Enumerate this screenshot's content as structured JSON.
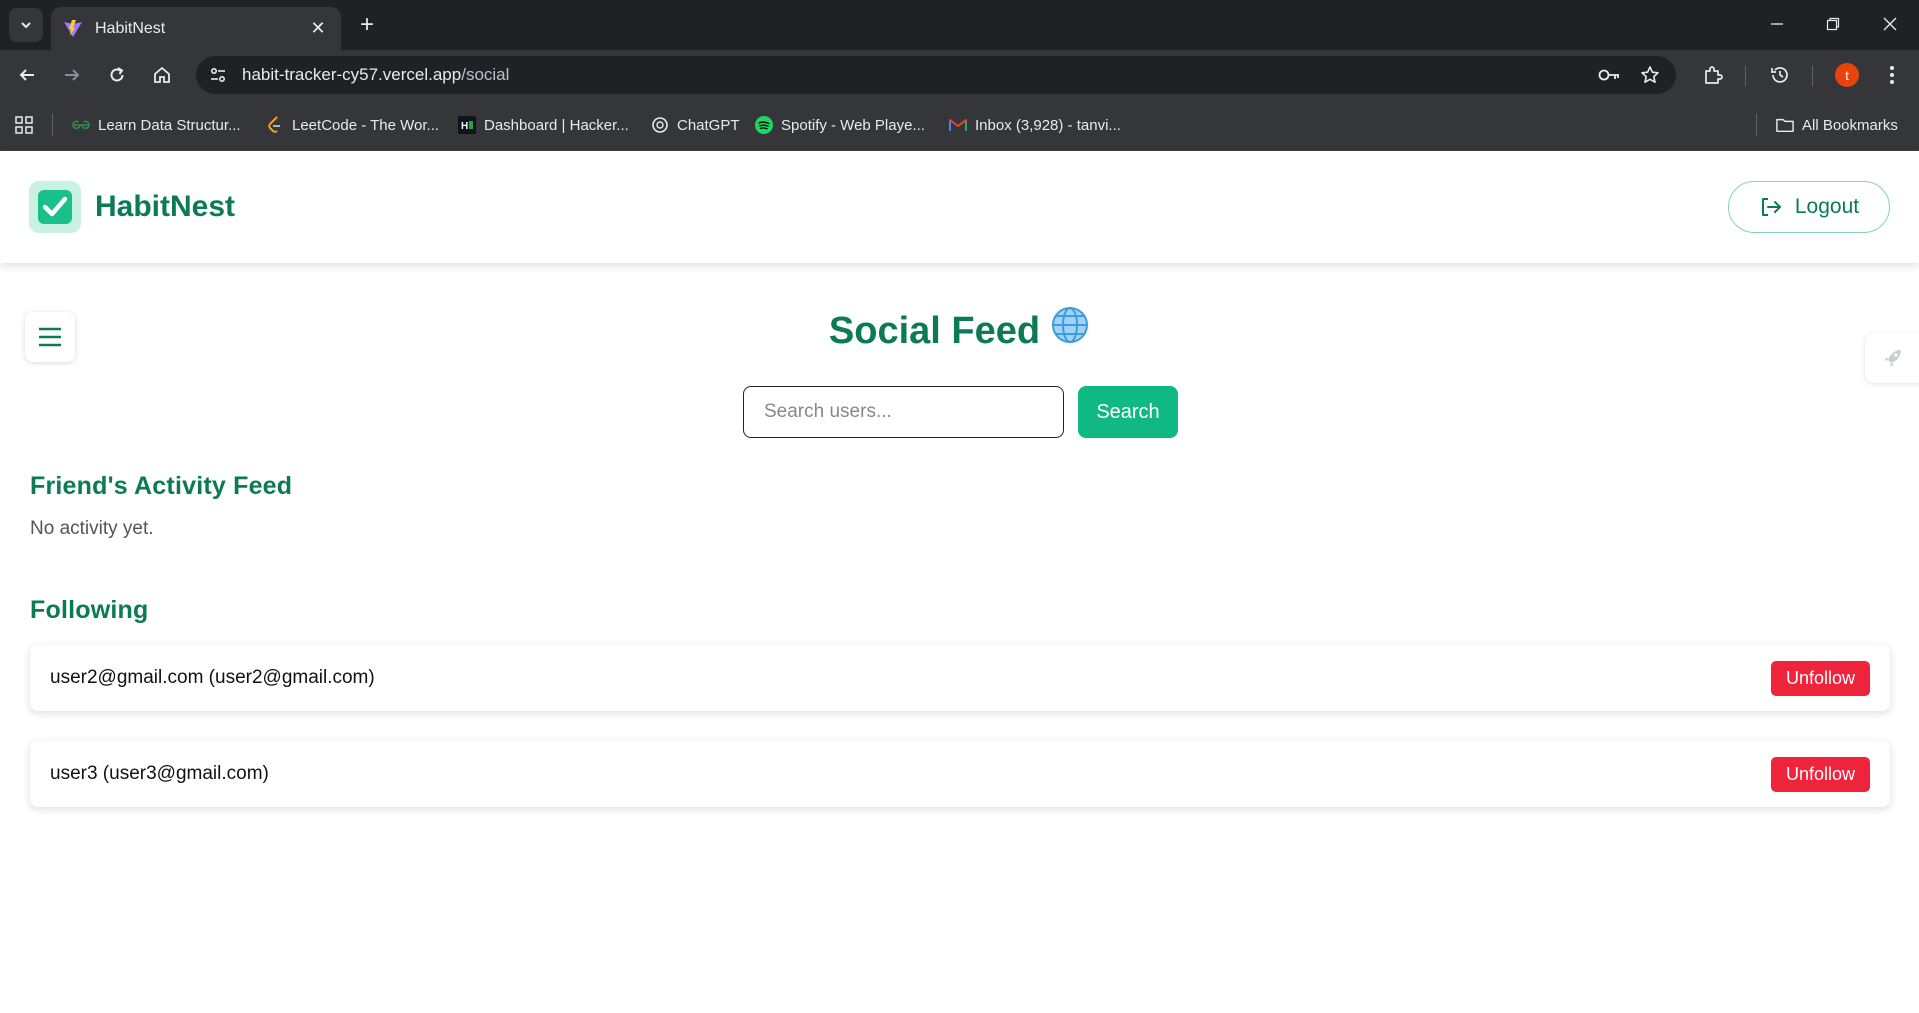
{
  "browser": {
    "tab_title": "HabitNest",
    "url_host": "habit-tracker-cy57.vercel.app",
    "url_path": "/social",
    "profile_initial": "t",
    "profile_color": "#e8430d",
    "bookmarks": [
      {
        "label": "Learn Data Structur...",
        "icon": "gfg-icon"
      },
      {
        "label": "LeetCode - The Wor...",
        "icon": "leetcode-icon"
      },
      {
        "label": "Dashboard | Hacker...",
        "icon": "hackerrank-icon"
      },
      {
        "label": "ChatGPT",
        "icon": "chatgpt-icon"
      },
      {
        "label": "Spotify - Web Playe...",
        "icon": "spotify-icon"
      },
      {
        "label": "Inbox (3,928) - tanvi...",
        "icon": "gmail-icon"
      }
    ],
    "all_bookmarks_label": "All Bookmarks"
  },
  "header": {
    "brand": "HabitNest",
    "logout_label": "Logout"
  },
  "main": {
    "title": "Social Feed",
    "search": {
      "placeholder": "Search users...",
      "value": "",
      "button_label": "Search"
    },
    "activity": {
      "title": "Friend's Activity Feed",
      "empty_text": "No activity yet."
    },
    "following": {
      "title": "Following",
      "users": [
        {
          "display": "user2@gmail.com (user2@gmail.com)",
          "action": "Unfollow"
        },
        {
          "display": "user3 (user3@gmail.com)",
          "action": "Unfollow"
        }
      ]
    }
  },
  "colors": {
    "brand_green": "#0b7a55",
    "accent_green": "#10b981",
    "danger_red": "#ef233c"
  }
}
